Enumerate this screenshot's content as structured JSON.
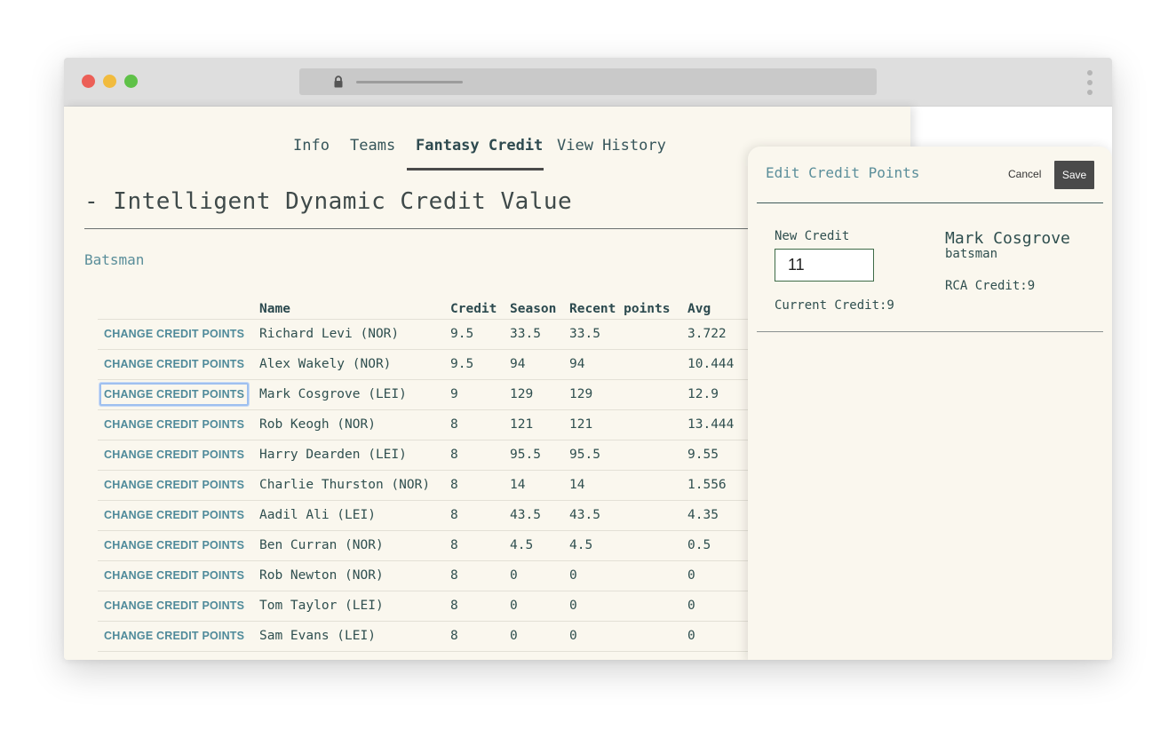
{
  "tabs": [
    {
      "label": "Info",
      "active": false
    },
    {
      "label": "Teams",
      "active": false
    },
    {
      "label": "Fantasy Credit",
      "active": true
    },
    {
      "label": "View History",
      "active": false
    }
  ],
  "page": {
    "title": "- Intelligent Dynamic Credit Value",
    "section": "Batsman"
  },
  "table": {
    "headers": [
      "",
      "Name",
      "Credit",
      "Season",
      "Recent points",
      "Avg"
    ],
    "action_label": "CHANGE CREDIT POINTS",
    "rows": [
      {
        "name": "Richard Levi (NOR)",
        "credit": "9.5",
        "season": "33.5",
        "recent": "33.5",
        "avg": "3.722"
      },
      {
        "name": "Alex Wakely (NOR)",
        "credit": "9.5",
        "season": "94",
        "recent": "94",
        "avg": "10.444"
      },
      {
        "name": "Mark Cosgrove (LEI)",
        "credit": "9",
        "season": "129",
        "recent": "129",
        "avg": "12.9"
      },
      {
        "name": "Rob Keogh (NOR)",
        "credit": "8",
        "season": "121",
        "recent": "121",
        "avg": "13.444"
      },
      {
        "name": "Harry Dearden (LEI)",
        "credit": "8",
        "season": "95.5",
        "recent": "95.5",
        "avg": "9.55"
      },
      {
        "name": "Charlie Thurston (NOR)",
        "credit": "8",
        "season": "14",
        "recent": "14",
        "avg": "1.556"
      },
      {
        "name": "Aadil Ali (LEI)",
        "credit": "8",
        "season": "43.5",
        "recent": "43.5",
        "avg": "4.35"
      },
      {
        "name": "Ben Curran (NOR)",
        "credit": "8",
        "season": "4.5",
        "recent": "4.5",
        "avg": "0.5"
      },
      {
        "name": "Rob Newton (NOR)",
        "credit": "8",
        "season": "0",
        "recent": "0",
        "avg": "0"
      },
      {
        "name": "Tom Taylor (LEI)",
        "credit": "8",
        "season": "0",
        "recent": "0",
        "avg": "0"
      },
      {
        "name": "Sam Evans (LEI)",
        "credit": "8",
        "season": "0",
        "recent": "0",
        "avg": "0"
      }
    ],
    "focused_row": 2
  },
  "panel": {
    "title": "Edit Credit Points",
    "cancel_label": "Cancel",
    "save_label": "Save",
    "new_credit_label": "New Credit",
    "new_credit_value": "11",
    "current_credit": "Current Credit:9",
    "player_name": "Mark Cosgrove",
    "player_role": "batsman",
    "rca_credit": "RCA Credit:9"
  },
  "colors": {
    "page_bg": "#faf7ee",
    "accent": "#5a8e9a",
    "text": "#2f4f4f",
    "save_button": "#4a4a4a",
    "input_border": "#3e6b47"
  },
  "icons": [
    "lock-icon",
    "browser-menu-icon"
  ]
}
